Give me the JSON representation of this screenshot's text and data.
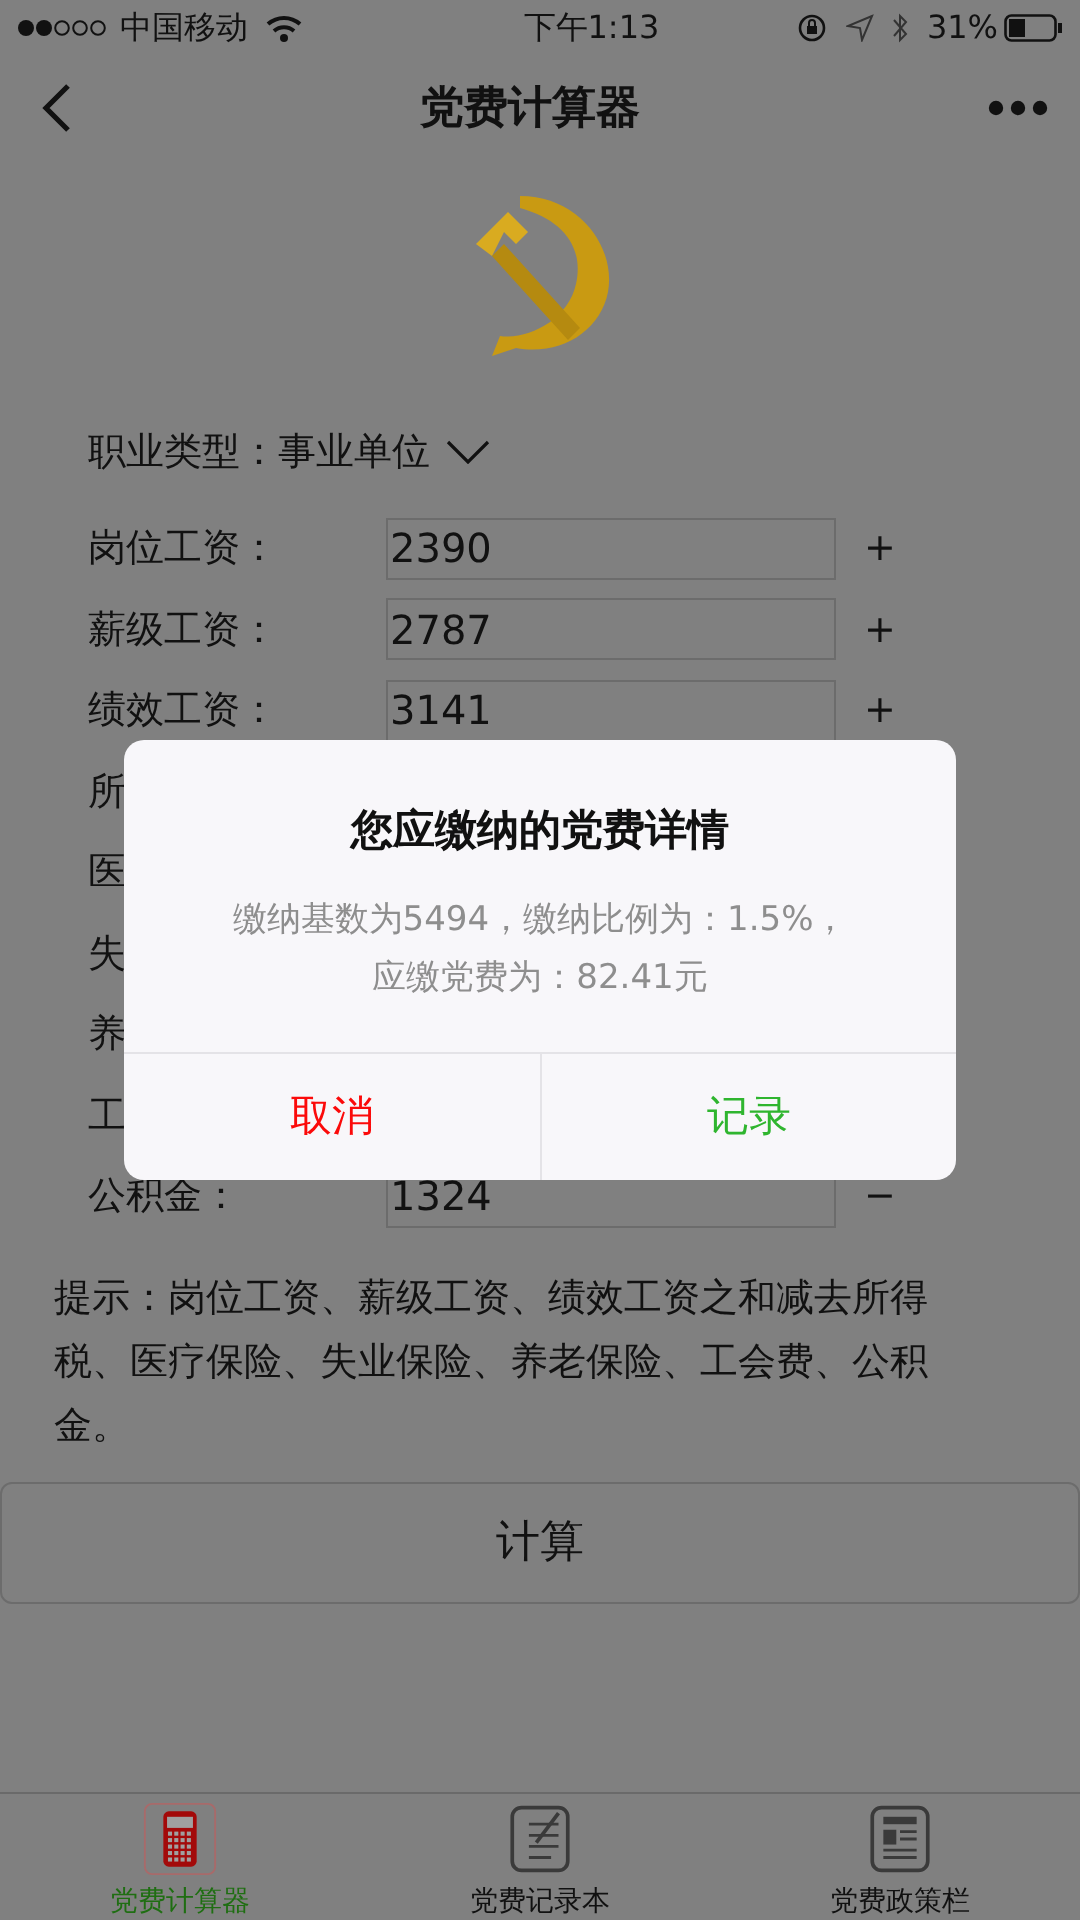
{
  "status_bar": {
    "carrier": "中国移动",
    "time": "下午1:13",
    "battery": "31%"
  },
  "nav": {
    "title": "党费计算器"
  },
  "job_type": {
    "label": "职业类型：",
    "value": "事业单位"
  },
  "rows": [
    {
      "label": "岗位工资：",
      "value": "2390",
      "sign": "+"
    },
    {
      "label": "薪级工资：",
      "value": "2787",
      "sign": "+"
    },
    {
      "label": "绩效工资：",
      "value": "3141",
      "sign": "+"
    },
    {
      "label": "所"
    },
    {
      "label": "医"
    },
    {
      "label": "失"
    },
    {
      "label": "养"
    },
    {
      "label": "工"
    },
    {
      "label": "公积金：",
      "value": "1324",
      "sign": "−"
    }
  ],
  "hint": "提示：岗位工资、薪级工资、绩效工资之和减去所得税、医疗保险、失业保险、养老保险、工会费、公积金。",
  "calculate_button": "计算",
  "dialog": {
    "title": "您应缴纳的党费详情",
    "message_lines": [
      "缴纳基数为5494，缴纳比例为：1.5%，",
      "应缴党费为：82.41元"
    ],
    "buttons": [
      {
        "label": "取消",
        "kind": "cancel"
      },
      {
        "label": "记录",
        "kind": "confirm"
      }
    ]
  },
  "tabs": [
    {
      "label": "党费计算器",
      "selected": true
    },
    {
      "label": "党费记录本",
      "selected": false
    },
    {
      "label": "党费政策栏",
      "selected": false
    }
  ]
}
